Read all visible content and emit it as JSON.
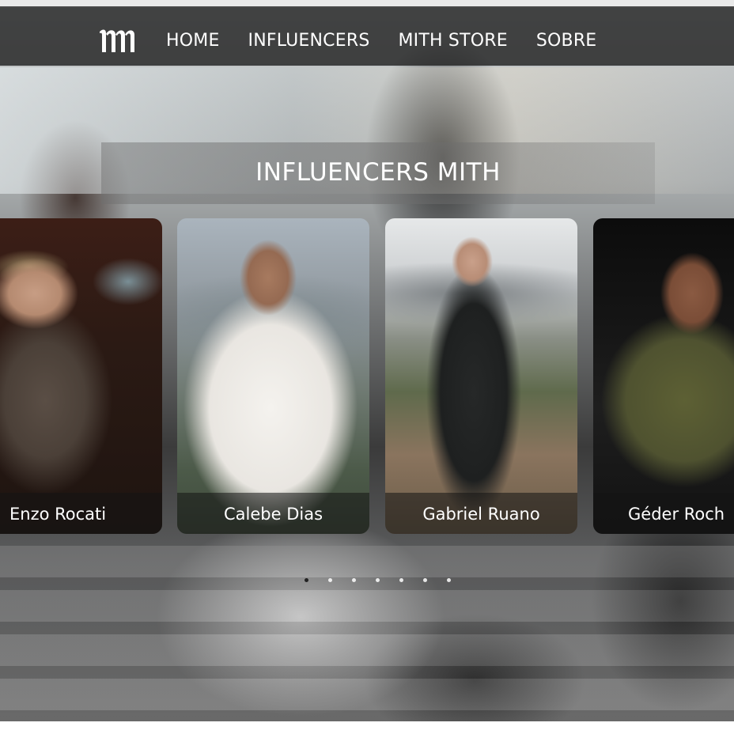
{
  "navbar": {
    "logo_alt": "MITH",
    "links": [
      {
        "label": "HOME"
      },
      {
        "label": "INFLUENCERS"
      },
      {
        "label": "MITH STORE"
      },
      {
        "label": "SOBRE"
      }
    ]
  },
  "section": {
    "title": "INFLUENCERS MITH"
  },
  "influencers": [
    {
      "name": "Enzo Rocati"
    },
    {
      "name": "Calebe Dias"
    },
    {
      "name": "Gabriel Ruano"
    },
    {
      "name": "Géder Roch"
    }
  ],
  "carousel": {
    "dot_count": 7,
    "active_index": 0
  },
  "colors": {
    "nav_background": "#191919",
    "text": "#ffffff",
    "active_dot": "#222222"
  },
  "icons": {
    "logo": "mith-logo-icon"
  }
}
